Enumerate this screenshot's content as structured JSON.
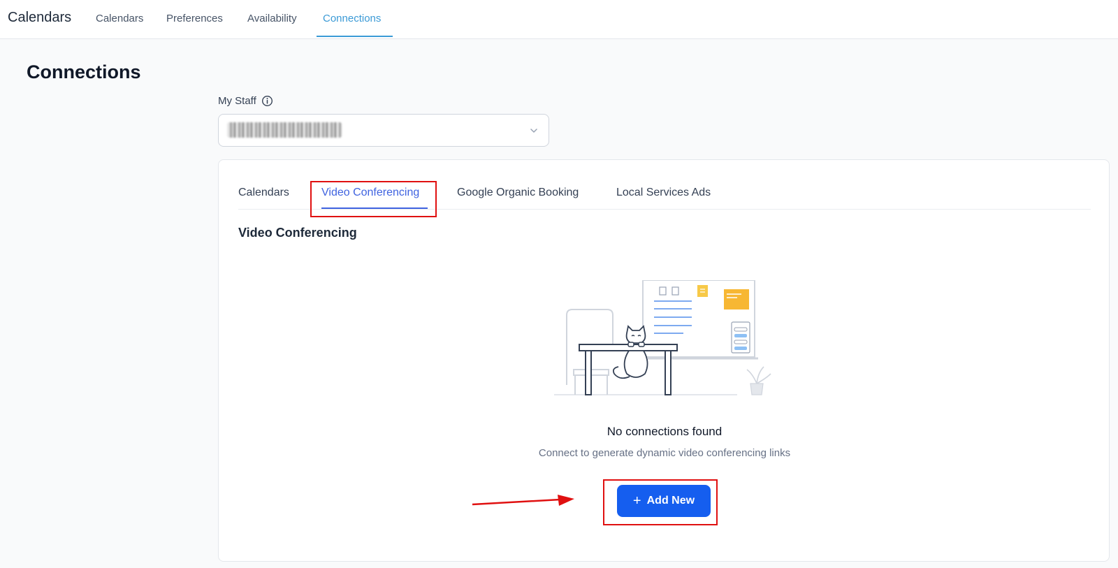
{
  "topnav": {
    "app_title": "Calendars",
    "tabs": [
      {
        "label": "Calendars",
        "active": false
      },
      {
        "label": "Preferences",
        "active": false
      },
      {
        "label": "Availability",
        "active": false
      },
      {
        "label": "Connections",
        "active": true
      }
    ]
  },
  "page": {
    "title": "Connections"
  },
  "staff": {
    "label": "My Staff",
    "info_icon": "info-circle-icon",
    "selected_value_redacted": true,
    "dropdown_icon": "chevron-down-icon"
  },
  "card": {
    "tabs": [
      {
        "label": "Calendars",
        "active": false
      },
      {
        "label": "Video Conferencing",
        "active": true
      },
      {
        "label": "Google Organic Booking",
        "active": false
      },
      {
        "label": "Local Services Ads",
        "active": false
      }
    ],
    "section_title": "Video Conferencing",
    "empty_state": {
      "illustration": "cat-under-desk-illustration",
      "title": "No connections found",
      "subtitle": "Connect to generate dynamic video conferencing links"
    },
    "add_button": {
      "icon": "plus-icon",
      "label": "Add New"
    }
  },
  "annotations": {
    "highlight_color": "#e01010",
    "arrow_target": "add-new-button"
  },
  "colors": {
    "accent_topnav": "#3b9ad6",
    "accent_tab": "#3f63e0",
    "primary_button": "#155eef"
  }
}
